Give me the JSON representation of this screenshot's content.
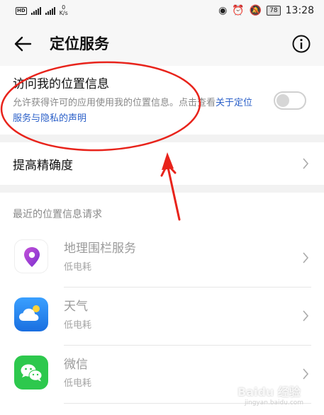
{
  "status_bar": {
    "hd": "HD",
    "sig1": "⁴⁶",
    "sig2": "⁴⁶",
    "speed_value": "0",
    "speed_unit": "K/s",
    "battery": "78",
    "time": "13:28"
  },
  "header": {
    "title": "定位服务"
  },
  "location_access": {
    "title": "访问我的位置信息",
    "desc_prefix": "允许获得许可的应用使用我的位置信息。点击查看",
    "desc_link": "关于定位服务与隐私的声明",
    "toggle_on": false
  },
  "accuracy": {
    "label": "提高精确度"
  },
  "recent": {
    "section_title": "最近的位置信息请求",
    "apps": [
      {
        "name": "地理围栏服务",
        "sub": "低电耗",
        "icon": "location-pin-icon"
      },
      {
        "name": "天气",
        "sub": "低电耗",
        "icon": "weather-icon"
      },
      {
        "name": "微信",
        "sub": "低电耗",
        "icon": "wechat-icon"
      }
    ]
  },
  "watermark": {
    "text": "Baidu 经验",
    "sub": "jingyan.baidu.com"
  },
  "colors": {
    "link": "#2a5fc8",
    "annotation": "#e8231b",
    "wechat": "#2dc84d",
    "weather": "#2b8bf0"
  }
}
